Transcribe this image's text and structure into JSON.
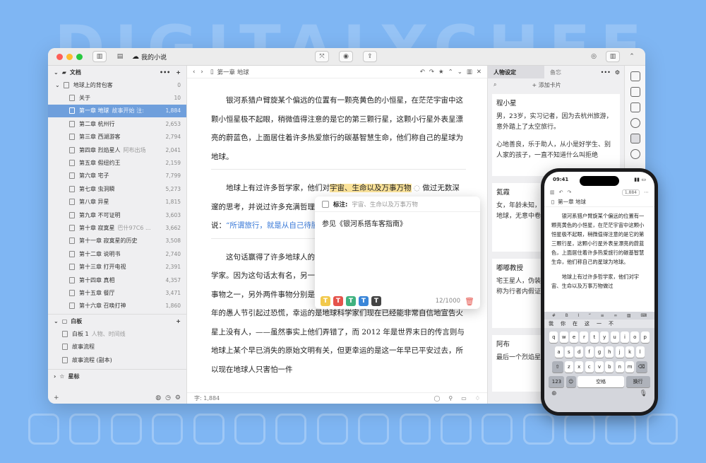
{
  "background_text": "DIGITALYCHEE",
  "colors": {
    "background": "#7fb6f3",
    "selected": "#6f9fdc",
    "highlight": "#fbe39a",
    "link": "#3a7ad8"
  },
  "window": {
    "title": "我的小说",
    "sidebar": {
      "header_label": "文档",
      "header_more": "•••",
      "header_add": "+",
      "project": {
        "label": "地球上的背包客",
        "count": "0"
      },
      "items": [
        {
          "label": "关于",
          "note": "",
          "count": "10"
        },
        {
          "label": "第一章 地球",
          "note": "故事开始 注:",
          "count": "1,884"
        },
        {
          "label": "第二章 杭州行",
          "note": "",
          "count": "2,653"
        },
        {
          "label": "第三章 西湖游客",
          "note": "",
          "count": "2,794"
        },
        {
          "label": "第四章 烈焰星人",
          "note": "阿布出场",
          "count": "2,041"
        },
        {
          "label": "第五章 假纽约王",
          "note": "",
          "count": "2,159"
        },
        {
          "label": "第六章 宅子",
          "note": "",
          "count": "7,799"
        },
        {
          "label": "第七章 虫洞瞬",
          "note": "",
          "count": "5,273"
        },
        {
          "label": "第八章 异星",
          "note": "",
          "count": "1,815"
        },
        {
          "label": "第九章 不可证明",
          "note": "",
          "count": "3,603"
        },
        {
          "label": "第十章 寂寞星",
          "note": "巴什97C6 ...",
          "count": "3,662"
        },
        {
          "label": "第十一章 寂寞星的历史",
          "note": "",
          "count": "3,508"
        },
        {
          "label": "第十二章 说明书",
          "note": "",
          "count": "2,740"
        },
        {
          "label": "第十三章 打开电视",
          "note": "",
          "count": "2,391"
        },
        {
          "label": "第十四章 真相",
          "note": "",
          "count": "4,357"
        },
        {
          "label": "第十五章 餐厅",
          "note": "",
          "count": "3,471"
        },
        {
          "label": "第十六章 召唤打神",
          "note": "",
          "count": "1,860"
        }
      ],
      "board_label": "白板",
      "board_add": "+",
      "boards": [
        {
          "label": "白板 1",
          "note": "人物、时间线"
        },
        {
          "label": "故事流程",
          "note": ""
        },
        {
          "label": "故事流程 (副本)",
          "note": ""
        }
      ],
      "star_label": "星标",
      "bottom_add": "+"
    },
    "editor": {
      "chapter_title": "第一章 地球",
      "paragraphs": [
        "银河系猎户臂旋某个偏远的位置有一颗亮黄色的小恒星，在茫茫宇宙中这颗小恒星极不起眼，稍微值得注意的是它的第三颗行星，这颗小行星外表呈漂亮的蔚蓝色，上面居住着许多热爱旅行的碳基智慧生命，他们称自己的星球为地球。"
      ],
      "para2_before": "地球上有过许多哲学家，他们对",
      "para2_highlight": "宇宙、生命以及万事万物",
      "para2_after": "做过无数深邃的思考，并说过许多充满哲理的话语。其中一位最著名的哲学家说的，他说：",
      "para2_quote": "“所谓旅行，就是从自己待腻了的地方到别人待腻了的地方。”",
      "para3": "这句话赢得了许多地球人的赞同，但没有人知道是谁最早说出这句话的哲学家。因为这句话太有名，另一位地球哲学家总结出来的世界上最可怕的三件事物之一，另外两件事物分别是火星人侵和 2012 年。火星人侵的消息曾在某年的愚人节引起过恐慌，幸运的是地球科学家们现在已经能非常自信地宣告火星上没有人，——虽然事实上他们弄错了，而 2012 年是世界末日的传言则与地球上某个早已消失的原始文明有关，但更幸运的是这一年早已平安过去，所以现在地球人只害怕一件",
      "status": "字: 1,884"
    },
    "annotation": {
      "label": "标注:",
      "target": "宇宙、生命以及万事万物",
      "text": "参见《银河系搭车客指南》",
      "counter": "12/1000",
      "swatch_letter": "T",
      "swatches": [
        "#f2c94c",
        "#e5534b",
        "#3fb27f",
        "#3a86d8",
        "#444444"
      ]
    },
    "right_panel": {
      "tab_active": "人物设定",
      "tab_other": "备忘",
      "more": "•••",
      "add_card": "+ 添加卡片",
      "cards": [
        {
          "title": "程小星",
          "lines": [
            "男，23岁，实习记者，因为去杭州旅游，意外踏上了太空旅行。",
            "心地善良，乐于助人，从小是好学生、别人家的孩子，一直不知道什么叫拒绝"
          ]
        },
        {
          "title": "氦霞",
          "lines": [
            "女，年龄未知，来自遥远星球的造访者，地球，无意中卷入了"
          ]
        },
        {
          "title": "嘟嘟教授",
          "lines": [
            "宅王星人，伪装成中年的外星科学家，被称为行者内假证。"
          ]
        },
        {
          "title": "阿布",
          "lines": [
            "最后一个烈焰星人，郁，觉得一切都"
          ]
        }
      ]
    }
  },
  "phone": {
    "time": "09:41",
    "word_count": "1,884",
    "chapter_title": "第一章 地球",
    "para1": "银河系猎户臂旋某个偏远的位置有一颗亮黄色的小恒星，在茫茫宇宙中这颗小恒星极不起眼，稍微值得注意的是它的第三颗行星，这颗小行星外表呈漂亮的蔚蓝色，上面居住着许多热爱旅行的碳基智慧生命，他们称自己的星球为地球。",
    "para2": "地球上有过许多哲学家，他们对宇宙、生命以及万事万物做过",
    "candidates": [
      "我",
      "你",
      "在",
      "这",
      "一",
      "不"
    ],
    "row1": [
      "q",
      "w",
      "e",
      "r",
      "t",
      "y",
      "u",
      "i",
      "o",
      "p"
    ],
    "row2": [
      "a",
      "s",
      "d",
      "f",
      "g",
      "h",
      "j",
      "k",
      "l"
    ],
    "row3": [
      "z",
      "x",
      "c",
      "v",
      "b",
      "n",
      "m"
    ],
    "key_123": "123",
    "key_space": "空格",
    "key_return": "换行"
  }
}
